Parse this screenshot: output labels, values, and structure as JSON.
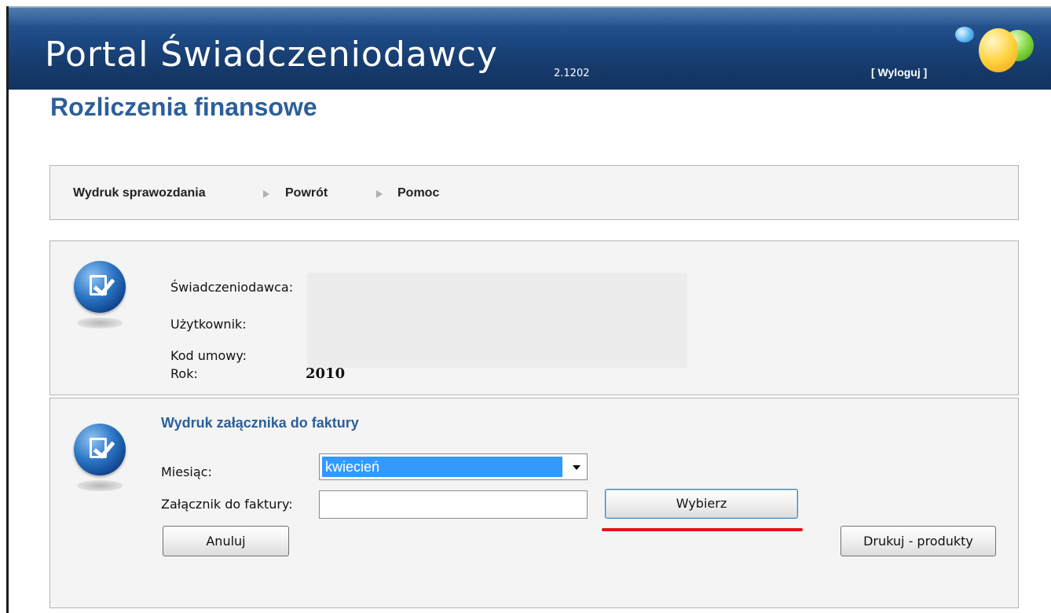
{
  "header": {
    "title": "Portal Świadczeniodawcy",
    "version": "2.1202",
    "logout_label": "[ Wyloguj ]"
  },
  "page_title": "Rozliczenia finansowe",
  "menu": {
    "items": [
      {
        "label": "Wydruk sprawozdania"
      },
      {
        "label": "Powrót"
      },
      {
        "label": "Pomoc"
      }
    ]
  },
  "info": {
    "provider_label": "Świadczeniodawca:",
    "user_label": "Użytkownik:",
    "contract_label": "Kod umowy:",
    "year_label": "Rok:",
    "year_value": "2010"
  },
  "form": {
    "section_title": "Wydruk załącznika do faktury",
    "month_label": "Miesiąc:",
    "month_selected": "kwiecień",
    "attachment_label": "Załącznik do faktury:",
    "attachment_value": "",
    "choose_label": "Wybierz",
    "cancel_label": "Anuluj",
    "print_label": "Drukuj - produkty"
  },
  "colors": {
    "header_bg": "#1d4a84",
    "title_blue": "#2b5f9c",
    "highlight": "#3399ff",
    "annotation_red": "#e3151a"
  }
}
